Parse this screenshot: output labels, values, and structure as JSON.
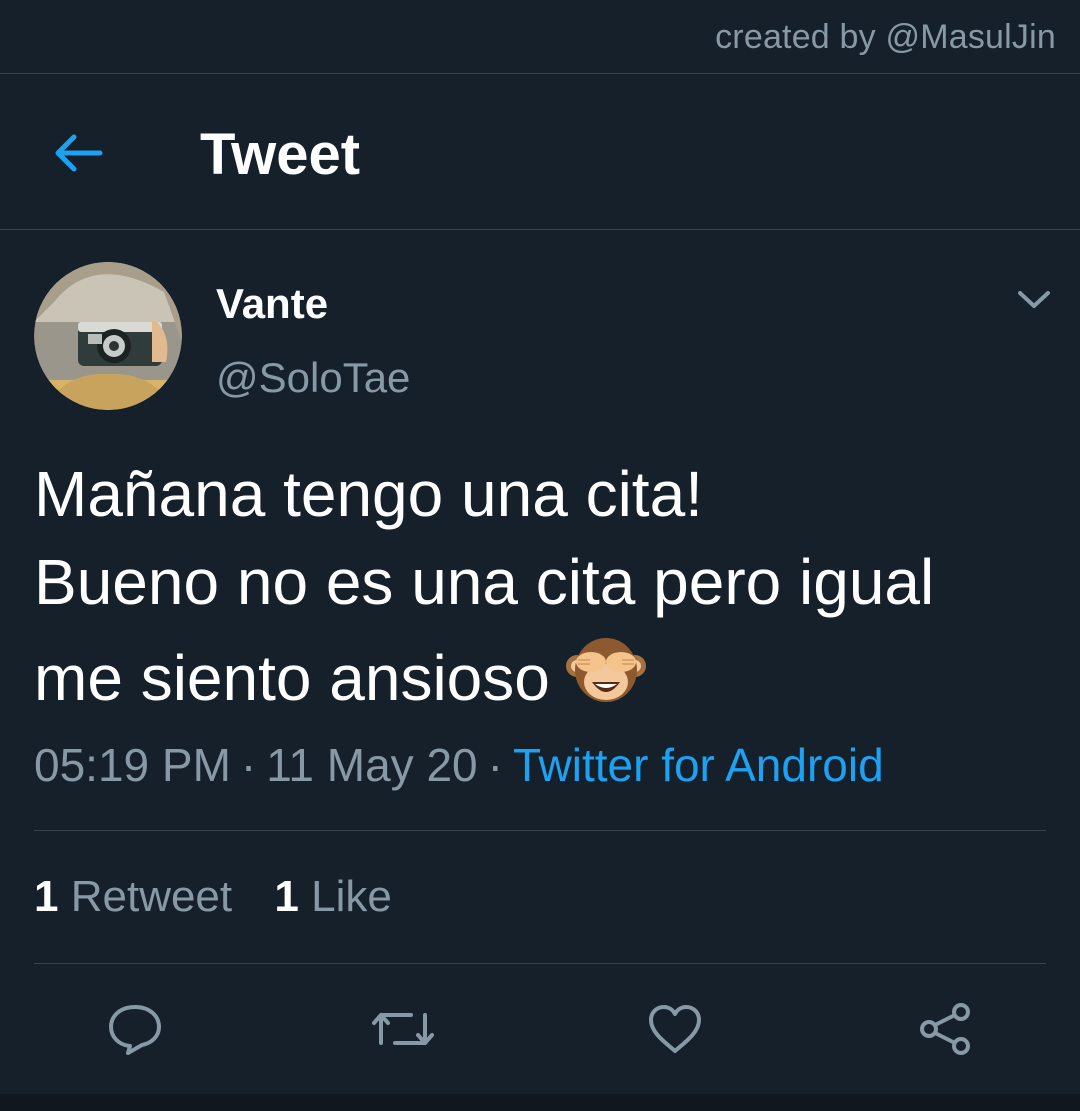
{
  "credit": "created by @MasulJin",
  "header": {
    "title": "Tweet",
    "back_icon": "arrow-left-icon"
  },
  "tweet": {
    "display_name": "Vante",
    "handle": "@SoloTae",
    "text_lines": [
      "Mañana tengo una cita!",
      "Bueno no es una cita pero igual",
      "me siento ansioso"
    ],
    "emoji": "see-no-evil-monkey",
    "time": "05:19 PM",
    "date": "11 May 20",
    "separator": "·",
    "source": "Twitter for Android"
  },
  "stats": {
    "retweets_count": "1",
    "retweets_label": "Retweet",
    "likes_count": "1",
    "likes_label": "Like"
  },
  "actions": [
    "reply-icon",
    "retweet-icon",
    "like-icon",
    "share-icon"
  ],
  "colors": {
    "background": "#15202b",
    "accent": "#1da1f2",
    "muted": "#8899a6",
    "border": "#38444d"
  }
}
